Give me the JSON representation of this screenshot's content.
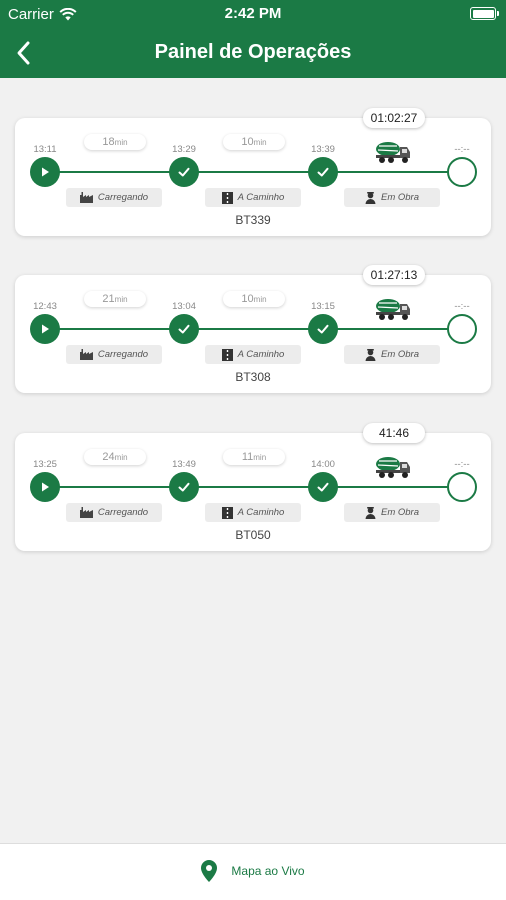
{
  "status_bar": {
    "carrier": "Carrier",
    "time": "2:42 PM"
  },
  "nav": {
    "title": "Painel de Operações"
  },
  "stage_labels": {
    "loading": "Carregando",
    "on_the_way": "A Caminho",
    "on_site": "Em Obra"
  },
  "orders": [
    {
      "code": "BT339",
      "elapsed": "01:02:27",
      "times": [
        "13:11",
        "13:29",
        "13:39",
        "--:--"
      ],
      "durations": [
        {
          "value": "18",
          "unit": "min"
        },
        {
          "value": "10",
          "unit": "min"
        }
      ]
    },
    {
      "code": "BT308",
      "elapsed": "01:27:13",
      "times": [
        "12:43",
        "13:04",
        "13:15",
        "--:--"
      ],
      "durations": [
        {
          "value": "21",
          "unit": "min"
        },
        {
          "value": "10",
          "unit": "min"
        }
      ]
    },
    {
      "code": "BT050",
      "elapsed": "41:46",
      "times": [
        "13:25",
        "13:49",
        "14:00",
        "--:--"
      ],
      "durations": [
        {
          "value": "24",
          "unit": "min"
        },
        {
          "value": "11",
          "unit": "min"
        }
      ]
    }
  ],
  "bottom": {
    "live_map_label": "Mapa ao Vivo"
  },
  "colors": {
    "primary": "#1b7a45",
    "background": "#f1f1f1",
    "chip": "#ececec"
  },
  "icons": [
    "wifi-icon",
    "battery-icon",
    "back-arrow-icon",
    "play-icon",
    "check-icon",
    "truck-mixer-icon",
    "factory-icon",
    "road-icon",
    "worker-icon",
    "location-pin-icon"
  ]
}
